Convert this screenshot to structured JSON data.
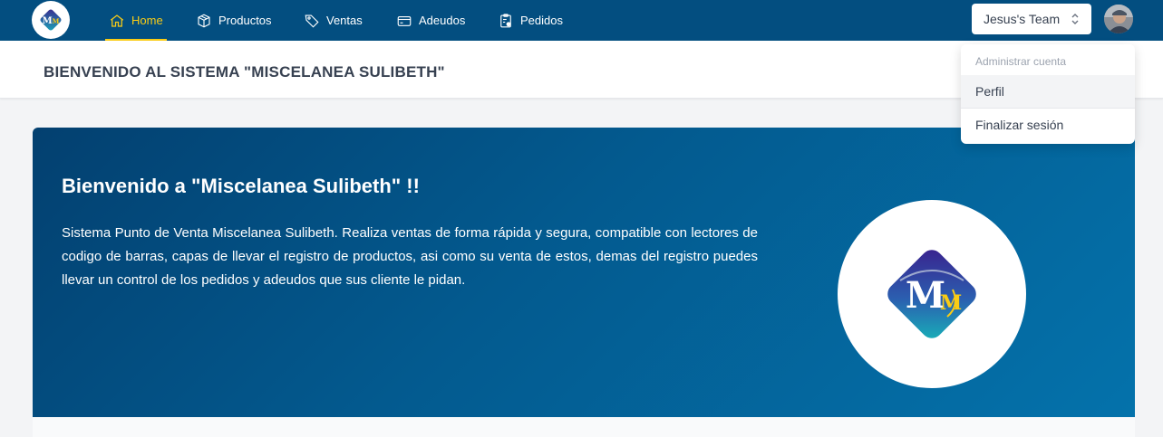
{
  "brand": {
    "logo_letters": "MM",
    "logo_icon": "miscelanea-logo"
  },
  "nav": {
    "items": [
      {
        "label": "Home",
        "icon": "home-icon",
        "active": true
      },
      {
        "label": "Productos",
        "icon": "box-icon",
        "active": false
      },
      {
        "label": "Ventas",
        "icon": "tag-icon",
        "active": false
      },
      {
        "label": "Adeudos",
        "icon": "credit-card-icon",
        "active": false
      },
      {
        "label": "Pedidos",
        "icon": "clipboard-icon",
        "active": false
      }
    ]
  },
  "team_select": {
    "value": "Jesus's Team"
  },
  "account_menu": {
    "heading": "Administrar cuenta",
    "items": [
      "Perfil",
      "Finalizar sesión"
    ]
  },
  "page": {
    "title": "BIENVENIDO AL SISTEMA \"MISCELANEA SULIBETH\""
  },
  "hero": {
    "title": "Bienvenido a \"Miscelanea Sulibeth\" !!",
    "text": "Sistema Punto de Venta Miscelanea Sulibeth. Realiza ventas de forma rápida y segura, compatible con lectores de codigo de barras, capas de llevar el registro de productos, asi como su venta de estos, demas del registro puedes llevar un control de los pedidos y adeudos que sus cliente le pidan."
  },
  "colors": {
    "nav_bg": "#034e80",
    "active_accent": "#facc15",
    "hero_start": "#034070",
    "hero_end": "#0472ab"
  }
}
